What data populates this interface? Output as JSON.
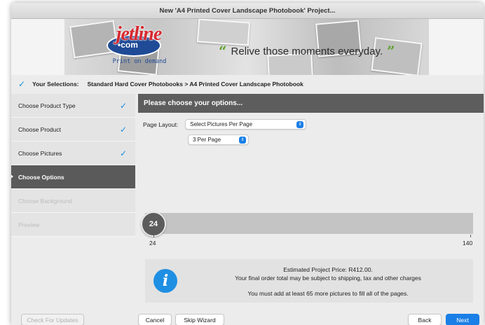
{
  "window": {
    "title": "New 'A4 Printed Cover Landscape Photobook' Project..."
  },
  "banner": {
    "logo_top": "jetline",
    "logo_mid": "•com",
    "logo_tagline": "Print on demand",
    "quote_open": "“",
    "quote_text": "Relive those moments everyday.",
    "quote_close": "”"
  },
  "selections": {
    "label": "Your Selections:",
    "value": "Standard Hard Cover Photobooks  >  A4 Printed Cover Landscape Photobook"
  },
  "sidebar": {
    "items": [
      {
        "label": "Choose Product Type",
        "checked": true
      },
      {
        "label": "Choose Product",
        "checked": true
      },
      {
        "label": "Choose Pictures",
        "checked": true
      },
      {
        "label": "Choose Options",
        "active": true
      },
      {
        "label": "Choose Background",
        "disabled": true
      },
      {
        "label": "Preview",
        "disabled": true
      }
    ]
  },
  "content": {
    "header": "Please choose your options...",
    "page_layout_label": "Page Layout:",
    "page_layout_value": "Select Pictures Per Page",
    "per_page_value": "3 Per Page"
  },
  "slider": {
    "value": 24,
    "min": 24,
    "max": 140,
    "value_label": "24",
    "min_label": "24",
    "max_label": "140"
  },
  "info": {
    "line1": "Estimated Project Price: R412.00.",
    "line2": "Your final order total may be subject to shipping, tax and other charges",
    "line3": "You must add at least 65 more pictures to fill all of the pages."
  },
  "buttons": {
    "check_updates": "Check For Updates",
    "cancel": "Cancel",
    "skip": "Skip Wizard",
    "back": "Back",
    "next": "Next"
  },
  "colors": {
    "accent": "#1a7fe6",
    "active_sidebar": "#5a5a5a",
    "quote_mark": "#5fa12a",
    "logo_red": "#d7282f",
    "logo_blue": "#1f4a96"
  }
}
